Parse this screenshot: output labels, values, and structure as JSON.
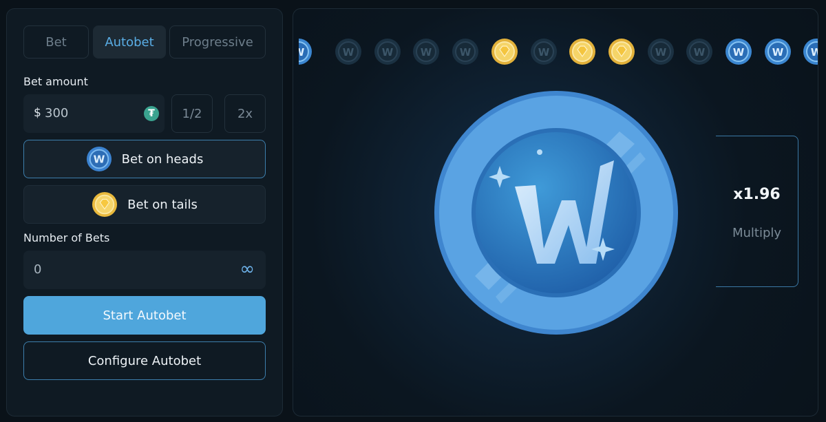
{
  "tabs": [
    {
      "label": "Bet",
      "active": false
    },
    {
      "label": "Autobet",
      "active": true
    },
    {
      "label": "Progressive",
      "active": false
    }
  ],
  "bet_amount": {
    "label": "Bet amount",
    "currency_symbol": "$",
    "value": "300",
    "currency_icon": "tether-icon",
    "half_label": "1/2",
    "double_label": "2x"
  },
  "choices": {
    "heads_label": "Bet on heads",
    "tails_label": "Bet on tails",
    "selected": "heads"
  },
  "number_of_bets": {
    "label": "Number of Bets",
    "value": "0",
    "infinity_symbol": "∞"
  },
  "actions": {
    "start_label": "Start Autobet",
    "configure_label": "Configure Autobet"
  },
  "history": [
    "heads-dim",
    "heads-dim",
    "heads-dim",
    "heads-dim",
    "tails",
    "heads-dim",
    "tails",
    "tails",
    "heads-dim",
    "heads-dim",
    "heads",
    "heads",
    "heads"
  ],
  "multiplier": {
    "value": "x1.96",
    "label": "Multiply"
  },
  "colors": {
    "accent_blue": "#4fa6dc",
    "heads_blue": "#4a90d9",
    "tails_gold": "#f2c94c",
    "panel_bg": "#0f1a23"
  }
}
